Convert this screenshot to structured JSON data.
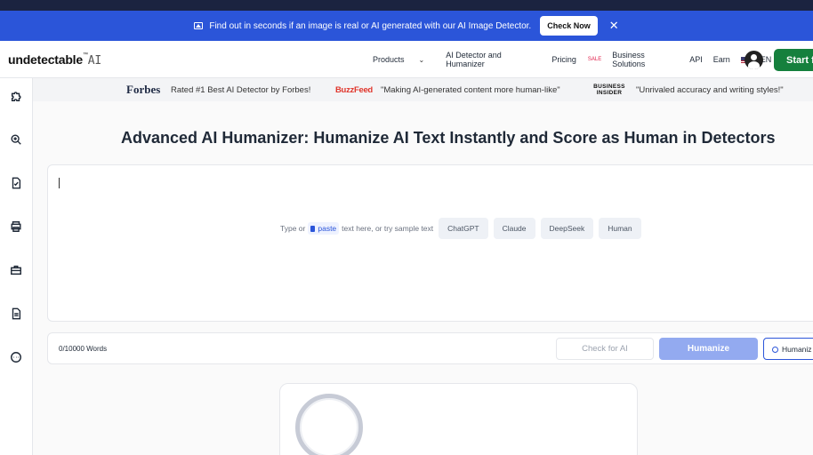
{
  "promo": {
    "text": "Find out in seconds if an image is real or AI generated with our AI Image Detector.",
    "button": "Check Now",
    "close": "✕"
  },
  "nav": {
    "logo_main": "undetectable",
    "logo_tm": "™",
    "logo_ai": "AI",
    "links": {
      "products": "Products",
      "detector": "AI Detector and Humanizer",
      "pricing": "Pricing",
      "pricing_badge": "SALE",
      "business": "Business Solutions",
      "api": "API",
      "earn": "Earn",
      "lang": "EN"
    },
    "chevron": "⌄",
    "start": "Start f"
  },
  "press": {
    "forbes_logo": "Forbes",
    "forbes_quote": "Rated #1 Best AI Detector by Forbes!",
    "buzz_logo": "BuzzFeed",
    "buzz_quote": "\"Making AI-generated content more human-like\"",
    "bi_logo_1": "BUSINESS",
    "bi_logo_2": "INSIDER",
    "bi_quote": "\"Unrivaled accuracy and writing styles!\""
  },
  "sidebar": {
    "icons": [
      "puzzle-icon",
      "search-zoom-icon",
      "document-check-icon",
      "printer-icon",
      "briefcase-icon",
      "document-icon",
      "more-icon"
    ]
  },
  "headline": {
    "plain": "Advanced AI Humanizer: ",
    "bold": "Humanize AI Text Instantly and Score as Human in Detectors"
  },
  "editor": {
    "hint_prefix": "Type or",
    "paste": "paste",
    "hint_suffix": "text here, or try sample text",
    "samples": [
      "ChatGPT",
      "Claude",
      "DeepSeek",
      "Human"
    ]
  },
  "toolbar": {
    "word_count": "0/10000 Words",
    "check_ai": "Check for AI",
    "humanize": "Humanize",
    "humanize_settings": "Humaniz"
  },
  "colors": {
    "brand_blue": "#2b55d9",
    "start_green": "#15803d",
    "humanize_disabled": "#93aaf0"
  }
}
